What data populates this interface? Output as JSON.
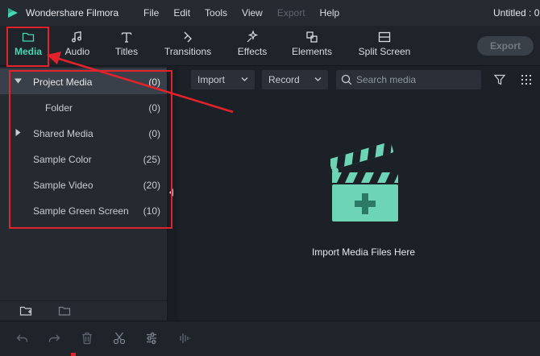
{
  "app": {
    "name": "Wondershare Filmora",
    "document_title": "Untitled : 0"
  },
  "menu": {
    "items": [
      {
        "label": "File",
        "enabled": true
      },
      {
        "label": "Edit",
        "enabled": true
      },
      {
        "label": "Tools",
        "enabled": true
      },
      {
        "label": "View",
        "enabled": true
      },
      {
        "label": "Export",
        "enabled": false
      },
      {
        "label": "Help",
        "enabled": true
      }
    ]
  },
  "tabs": [
    {
      "label": "Media",
      "icon": "folder-icon",
      "active": true
    },
    {
      "label": "Audio",
      "icon": "music-note-icon",
      "active": false
    },
    {
      "label": "Titles",
      "icon": "text-t-icon",
      "active": false
    },
    {
      "label": "Transitions",
      "icon": "transitions-icon",
      "active": false
    },
    {
      "label": "Effects",
      "icon": "effects-icon",
      "active": false
    },
    {
      "label": "Elements",
      "icon": "elements-icon",
      "active": false
    },
    {
      "label": "Split Screen",
      "icon": "split-screen-icon",
      "active": false
    }
  ],
  "export_button": {
    "label": "Export",
    "enabled": false
  },
  "sidebar": {
    "items": [
      {
        "name": "Project Media",
        "count": "(0)",
        "expanded": true,
        "selected": true
      },
      {
        "name": "Folder",
        "count": "(0)",
        "child": true
      },
      {
        "name": "Shared Media",
        "count": "(0)",
        "expanded": false
      },
      {
        "name": "Sample Color",
        "count": "(25)"
      },
      {
        "name": "Sample Video",
        "count": "(20)"
      },
      {
        "name": "Sample Green Screen",
        "count": "(10)"
      }
    ]
  },
  "media_toolbar": {
    "import_label": "Import",
    "record_label": "Record",
    "search_placeholder": "Search media"
  },
  "empty_state": {
    "hint": "Import Media Files Here"
  },
  "colors": {
    "accent": "#48d6b4",
    "annotation": "#e3232c",
    "clapper": "#6dd4b6"
  }
}
